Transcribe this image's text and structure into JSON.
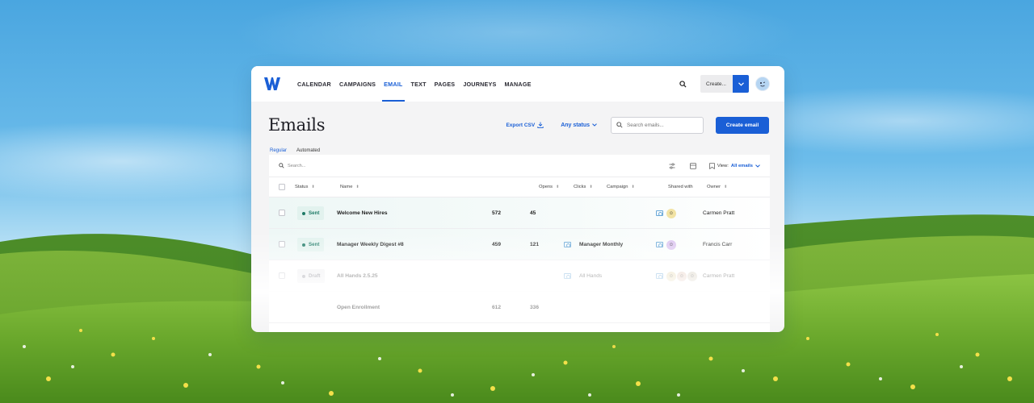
{
  "nav": {
    "items": [
      {
        "label": "CALENDAR",
        "active": false
      },
      {
        "label": "CAMPAIGNS",
        "active": false
      },
      {
        "label": "EMAIL",
        "active": true
      },
      {
        "label": "TEXT",
        "active": false
      },
      {
        "label": "PAGES",
        "active": false
      },
      {
        "label": "JOURNEYS",
        "active": false
      },
      {
        "label": "MANAGE",
        "active": false
      }
    ],
    "create_label": "Create..."
  },
  "page": {
    "title": "Emails",
    "export_label": "Export CSV",
    "status_filter": "Any status",
    "search_placeholder": "Search emails...",
    "create_button": "Create email"
  },
  "subtabs": [
    "Regular",
    "Automated"
  ],
  "table": {
    "search_placeholder": "Search...",
    "view_label": "View:",
    "view_value": "All emails",
    "columns": {
      "status": "Status",
      "name": "Name",
      "opens": "Opens",
      "clicks": "Clicks",
      "campaign": "Campaign",
      "shared": "Shared with",
      "owner": "Owner"
    },
    "rows": [
      {
        "status": "Sent",
        "name": "Welcome New Hires",
        "opens": "572",
        "clicks": "45",
        "campaign": "",
        "owner": "Carmen Pratt"
      },
      {
        "status": "Sent",
        "name": "Manager Weekly Digest #8",
        "opens": "459",
        "clicks": "121",
        "campaign": "Manager Monthly",
        "owner": "Francis Carr"
      },
      {
        "status": "Draft",
        "name": "All Hands 2.5.25",
        "opens": "",
        "clicks": "",
        "campaign": "All Hands",
        "owner": "Carmen Pratt"
      },
      {
        "status": "",
        "name": "Open Enrollment",
        "opens": "612",
        "clicks": "336",
        "campaign": "",
        "owner": ""
      }
    ]
  },
  "colors": {
    "accent": "#1a5fd6",
    "sent_badge": "#e2f2ee",
    "sent_text": "#1e7a66",
    "draft_badge": "#ededf0"
  }
}
